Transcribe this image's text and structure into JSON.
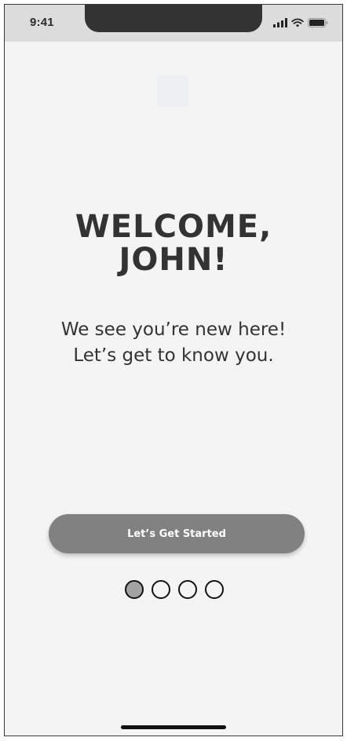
{
  "status_bar": {
    "time": "9:41",
    "icons": [
      "cellular-signal-icon",
      "wifi-icon",
      "battery-icon"
    ]
  },
  "logo": {
    "icon": "app-logo-placeholder"
  },
  "welcome": {
    "line1": "WELCOME,",
    "line2": "JOHN!"
  },
  "subtitle": {
    "line1": "We see you’re new here!",
    "line2": "Let’s get to know you."
  },
  "cta": {
    "label": "Let’s Get Started"
  },
  "pagination": {
    "total": 4,
    "active_index": 0
  },
  "colors": {
    "background": "#f4f4f4",
    "status_bar": "#dcdcdc",
    "button": "#818181",
    "text": "#333333",
    "active_dot": "#a3a3a3"
  }
}
